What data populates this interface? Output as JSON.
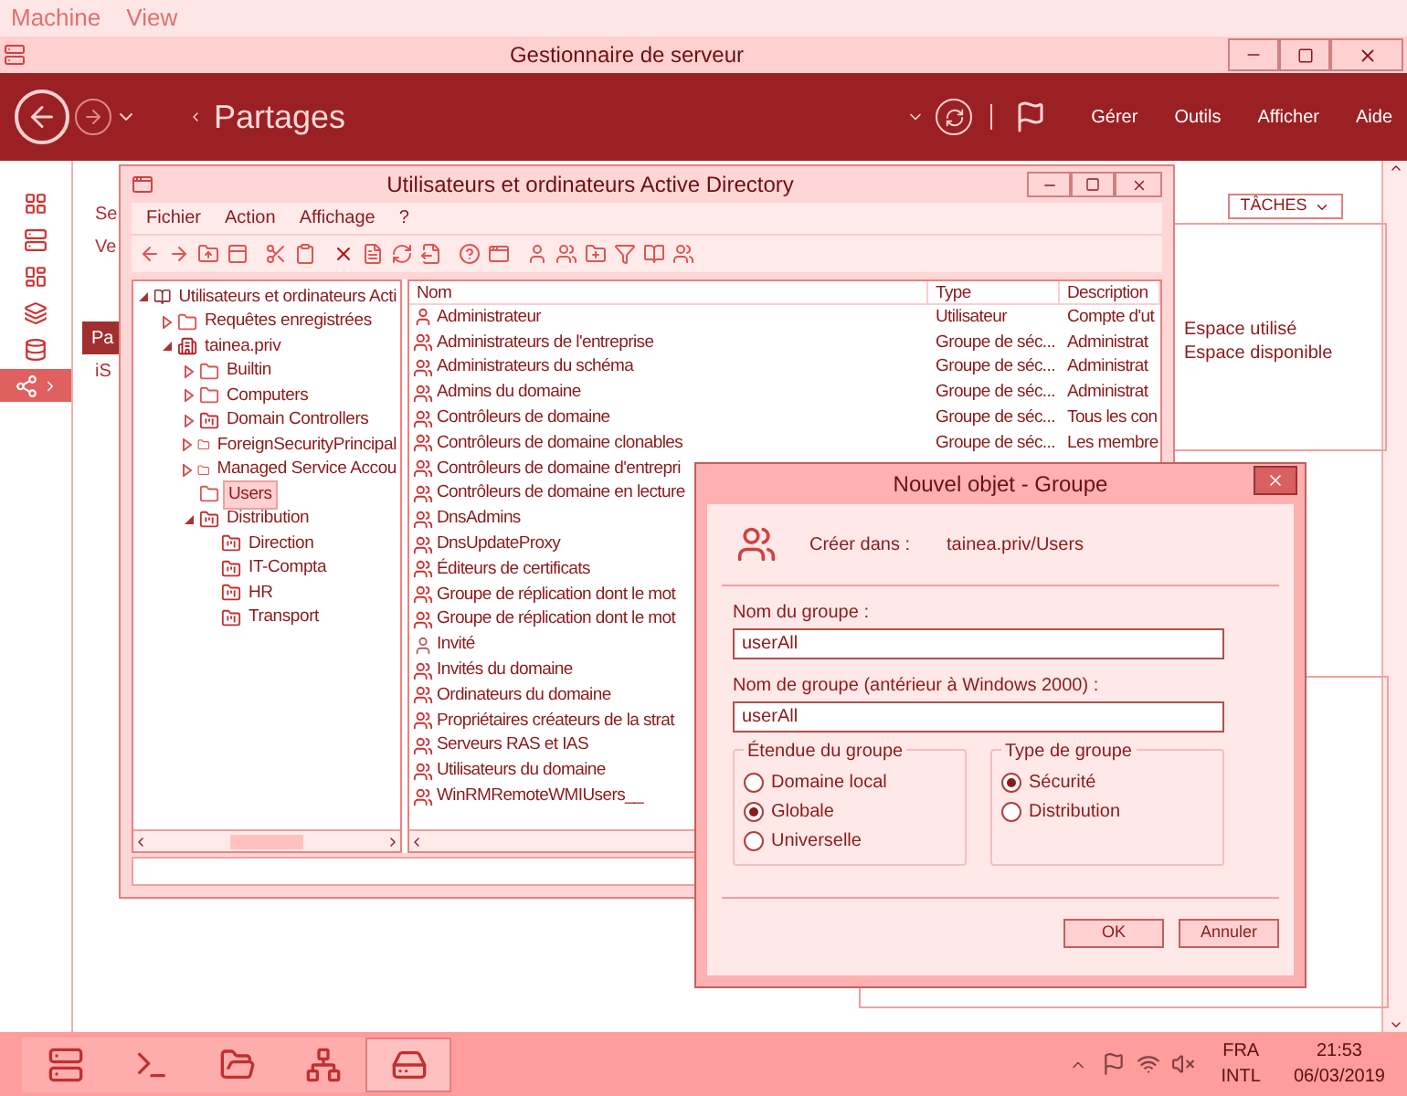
{
  "vm_menu": [
    "Machine",
    "View"
  ],
  "window": {
    "title": "Gestionnaire de serveur"
  },
  "header": {
    "title": "Partages",
    "menu": [
      "Gérer",
      "Outils",
      "Afficher",
      "Aide"
    ]
  },
  "sidebar": {
    "items": [
      {
        "selected": false
      },
      {
        "selected": false
      },
      {
        "selected": false
      },
      {
        "selected": false
      },
      {
        "selected": false
      },
      {
        "selected": true
      }
    ]
  },
  "nav": {
    "items": [
      {
        "label": "Se",
        "selected": false
      },
      {
        "label": "Ve",
        "selected": false
      },
      {
        "label": "Pa",
        "selected": true
      },
      {
        "label": "iS",
        "selected": false
      }
    ]
  },
  "tasks_button": "TÂCHES",
  "volume_panel": {
    "lines": [
      "Espace utilisé",
      "Espace disponible"
    ]
  },
  "ad_window": {
    "title": "Utilisateurs et ordinateurs Active Directory",
    "menu": [
      "Fichier",
      "Action",
      "Affichage",
      "?"
    ],
    "tree": [
      {
        "label": "Utilisateurs et ordinateurs Acti",
        "kind": "root",
        "expanded": true,
        "selected": false,
        "children": [
          {
            "label": "Requêtes enregistrées",
            "kind": "folder",
            "expanded": false,
            "selected": false
          },
          {
            "label": "tainea.priv",
            "kind": "domain",
            "expanded": true,
            "selected": false,
            "children": [
              {
                "label": "Builtin",
                "kind": "folder",
                "expanded": false,
                "selected": false
              },
              {
                "label": "Computers",
                "kind": "folder",
                "expanded": false,
                "selected": false
              },
              {
                "label": "Domain Controllers",
                "kind": "ou",
                "expanded": false,
                "selected": false
              },
              {
                "label": "ForeignSecurityPrincipal",
                "kind": "folder",
                "expanded": false,
                "selected": false
              },
              {
                "label": "Managed Service Accou",
                "kind": "folder",
                "expanded": false,
                "selected": false
              },
              {
                "label": "Users",
                "kind": "folder",
                "selected": true
              },
              {
                "label": "Distribution",
                "kind": "ou",
                "expanded": true,
                "selected": false,
                "children": [
                  {
                    "label": "Direction",
                    "kind": "ou",
                    "selected": false
                  },
                  {
                    "label": "IT-Compta",
                    "kind": "ou",
                    "selected": false
                  },
                  {
                    "label": "HR",
                    "kind": "ou",
                    "selected": false
                  },
                  {
                    "label": "Transport",
                    "kind": "ou",
                    "selected": false
                  }
                ]
              }
            ]
          }
        ]
      }
    ],
    "columns": [
      "Nom",
      "Type",
      "Description"
    ],
    "rows": [
      {
        "kind": "user",
        "name": "Administrateur",
        "type": "Utilisateur",
        "description": "Compte d'ut"
      },
      {
        "kind": "group",
        "name": "Administrateurs de l'entreprise",
        "type": "Groupe de séc...",
        "description": "Administrat"
      },
      {
        "kind": "group",
        "name": "Administrateurs du schéma",
        "type": "Groupe de séc...",
        "description": "Administrat"
      },
      {
        "kind": "group",
        "name": "Admins du domaine",
        "type": "Groupe de séc...",
        "description": "Administrat"
      },
      {
        "kind": "group",
        "name": "Contrôleurs de domaine",
        "type": "Groupe de séc...",
        "description": "Tous les con"
      },
      {
        "kind": "group",
        "name": "Contrôleurs de domaine clonables",
        "type": "Groupe de séc...",
        "description": "Les membre"
      },
      {
        "kind": "group",
        "name": "Contrôleurs de domaine d'entrepri"
      },
      {
        "kind": "group",
        "name": "Contrôleurs de domaine en lecture"
      },
      {
        "kind": "group",
        "name": "DnsAdmins"
      },
      {
        "kind": "group",
        "name": "DnsUpdateProxy"
      },
      {
        "kind": "group",
        "name": "Éditeurs de certificats"
      },
      {
        "kind": "group",
        "name": "Groupe de réplication dont le mot"
      },
      {
        "kind": "group",
        "name": "Groupe de réplication dont le mot"
      },
      {
        "kind": "guest",
        "name": "Invité"
      },
      {
        "kind": "group",
        "name": "Invités du domaine"
      },
      {
        "kind": "group",
        "name": "Ordinateurs du domaine"
      },
      {
        "kind": "group",
        "name": "Propriétaires créateurs de la strat"
      },
      {
        "kind": "group",
        "name": "Serveurs RAS et IAS"
      },
      {
        "kind": "group",
        "name": "Utilisateurs du domaine"
      },
      {
        "kind": "group",
        "name": "WinRMRemoteWMIUsers__"
      }
    ]
  },
  "dialog": {
    "title": "Nouvel objet - Groupe",
    "create_in_label": "Créer dans :",
    "create_in_value": "tainea.priv/Users",
    "fields": [
      {
        "label": "Nom du groupe :",
        "value": "userAll"
      },
      {
        "label": "Nom de groupe (antérieur à Windows 2000) :",
        "value": "userAll"
      }
    ],
    "groups": [
      {
        "title": "Étendue du groupe",
        "options": [
          {
            "label": "Domaine local",
            "selected": false
          },
          {
            "label": "Globale",
            "selected": true
          },
          {
            "label": "Universelle",
            "selected": false
          }
        ]
      },
      {
        "title": "Type de groupe",
        "options": [
          {
            "label": "Sécurité",
            "selected": true
          },
          {
            "label": "Distribution",
            "selected": false
          }
        ]
      }
    ],
    "buttons": [
      "OK",
      "Annuler"
    ]
  },
  "taskbar": {
    "apps": [
      {
        "selected": false
      },
      {
        "selected": false
      },
      {
        "selected": false
      },
      {
        "selected": false
      },
      {
        "selected": true
      }
    ],
    "language": "FRA",
    "keyboard": "INTL",
    "time": "21:53",
    "date": "06/03/2019"
  }
}
